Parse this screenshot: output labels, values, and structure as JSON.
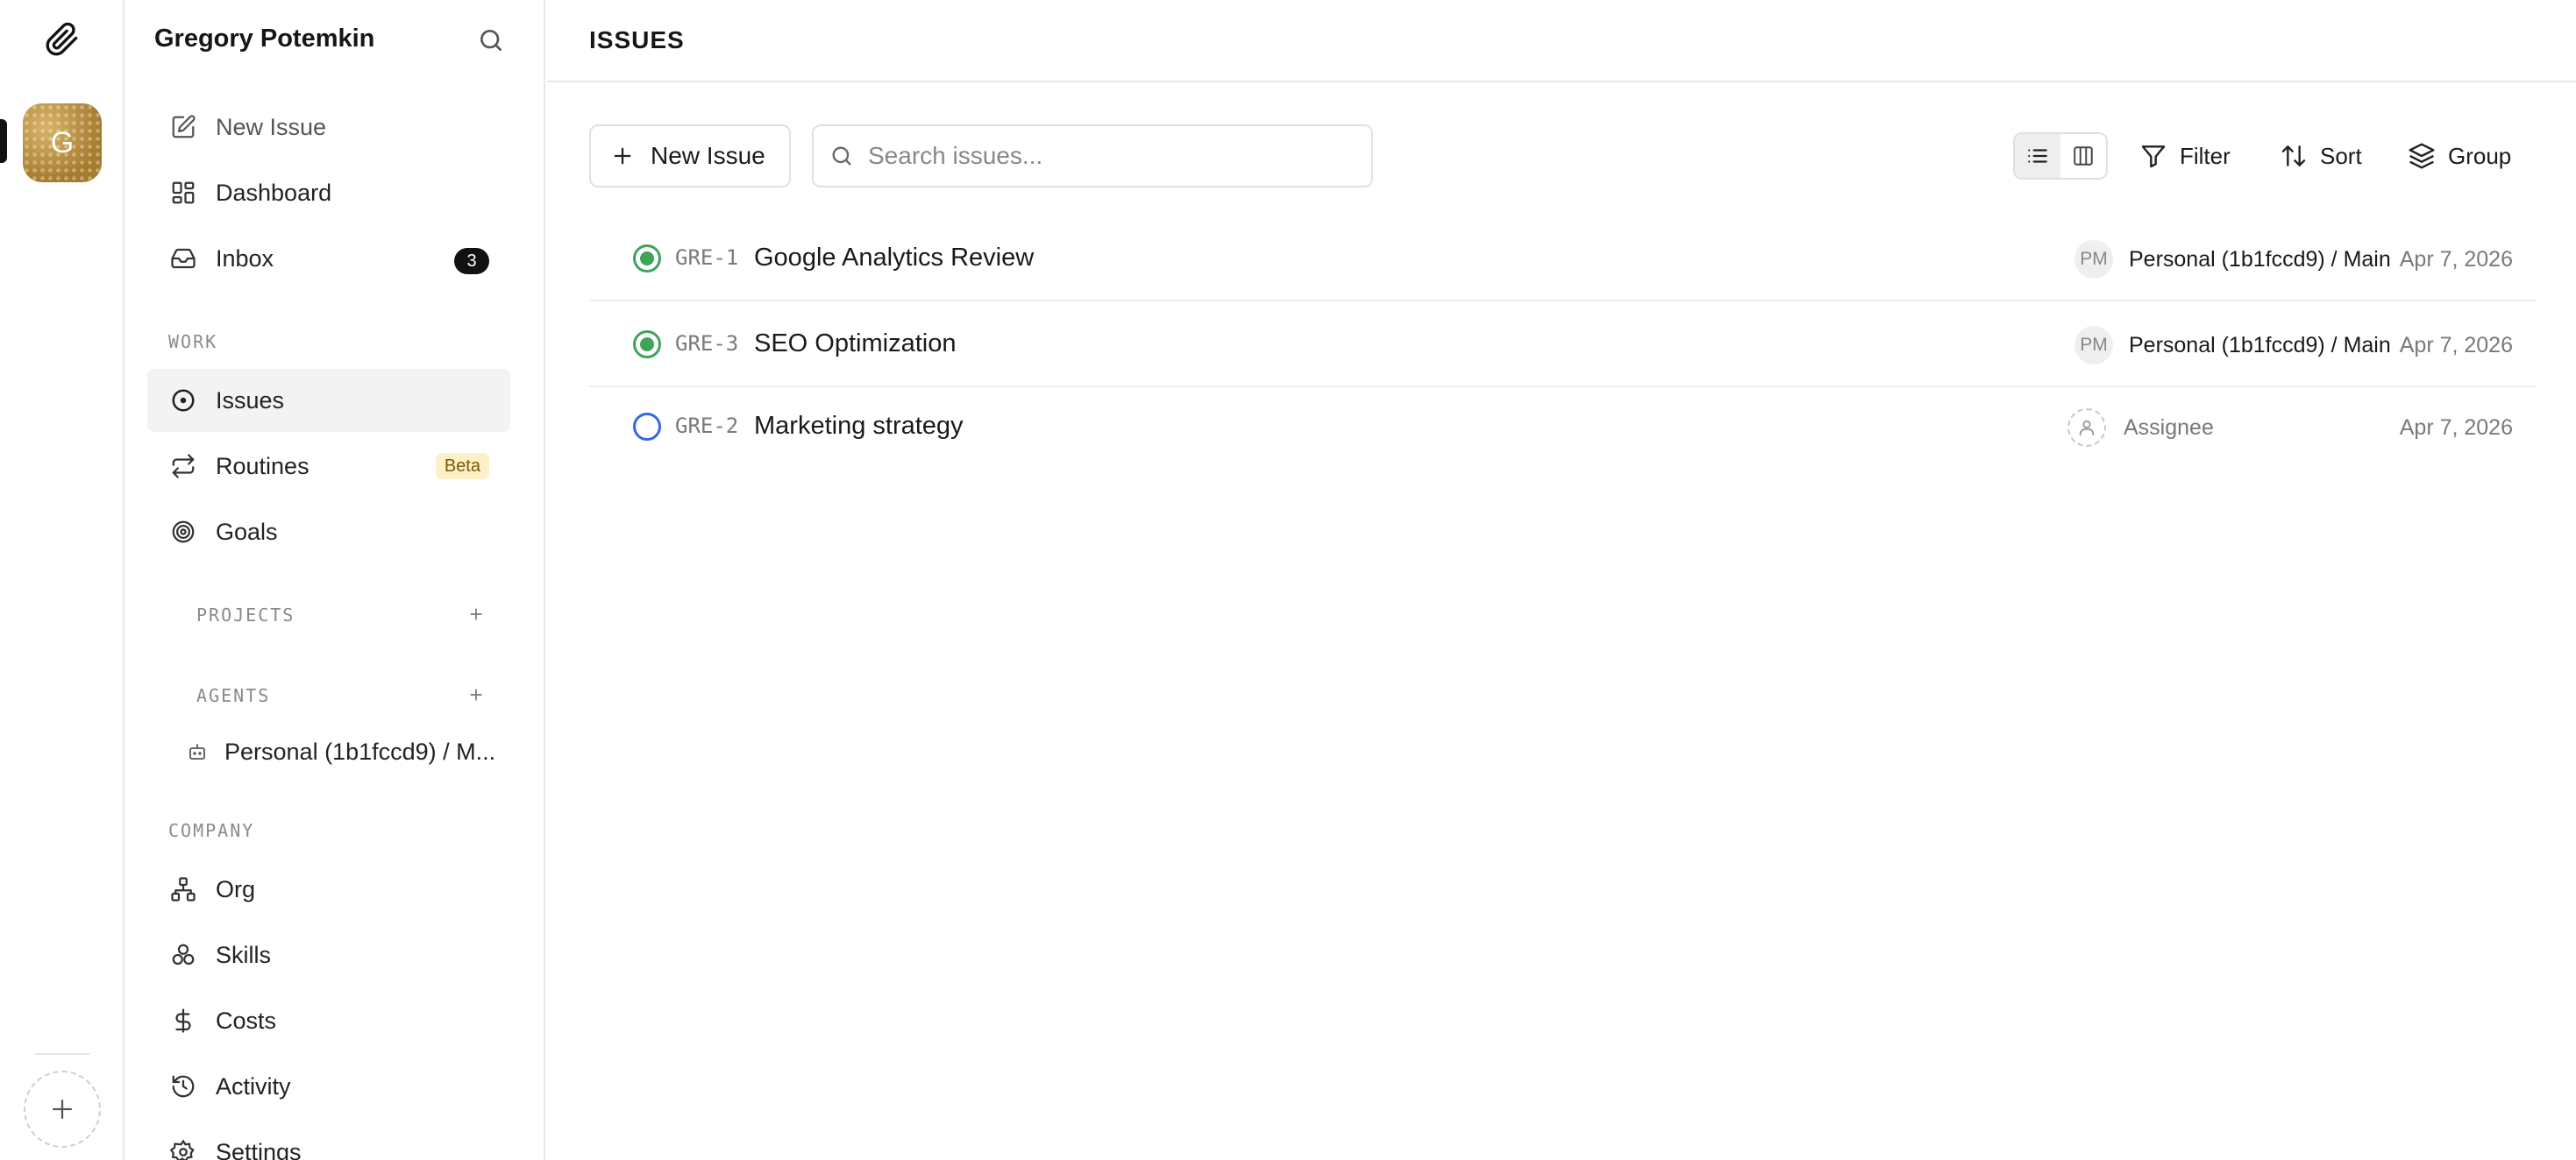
{
  "rail": {
    "avatar_letter": "G",
    "icons": {
      "logo": "paperclip-icon",
      "add": "plus-icon"
    }
  },
  "sidebar": {
    "workspace_name": "Gregory Potemkin",
    "top_items": [
      {
        "label": "New Issue",
        "icon": "edit-icon"
      },
      {
        "label": "Dashboard",
        "icon": "dashboard-icon"
      },
      {
        "label": "Inbox",
        "icon": "inbox-icon",
        "badge": "3"
      }
    ],
    "work_label": "WORK",
    "work_items": [
      {
        "label": "Issues",
        "icon": "circle-dot-icon",
        "active": true
      },
      {
        "label": "Routines",
        "icon": "repeat-icon",
        "badge": "Beta"
      },
      {
        "label": "Goals",
        "icon": "target-icon"
      }
    ],
    "projects_label": "PROJECTS",
    "agents_label": "AGENTS",
    "agents": [
      {
        "label": "Personal (1b1fccd9) / M...",
        "icon": "bot-icon"
      }
    ],
    "company_label": "COMPANY",
    "company_items": [
      {
        "label": "Org",
        "icon": "org-chart-icon"
      },
      {
        "label": "Skills",
        "icon": "skills-icon"
      },
      {
        "label": "Costs",
        "icon": "dollar-icon"
      },
      {
        "label": "Activity",
        "icon": "history-icon"
      },
      {
        "label": "Settings",
        "icon": "gear-icon"
      }
    ]
  },
  "main": {
    "title": "ISSUES",
    "new_issue_label": "New Issue",
    "search_placeholder": "Search issues...",
    "toolbar": {
      "filter_label": "Filter",
      "sort_label": "Sort",
      "group_label": "Group"
    },
    "issues": [
      {
        "key": "GRE-1",
        "title": "Google Analytics Review",
        "status": "done",
        "assignee_initials": "PM",
        "project": "Personal (1b1fccd9) / Main",
        "date": "Apr 7, 2026"
      },
      {
        "key": "GRE-3",
        "title": "SEO Optimization",
        "status": "done",
        "assignee_initials": "PM",
        "project": "Personal (1b1fccd9) / Main",
        "date": "Apr 7, 2026"
      },
      {
        "key": "GRE-2",
        "title": "Marketing strategy",
        "status": "todo",
        "assignee_placeholder": "Assignee",
        "date": "Apr 7, 2026"
      }
    ]
  },
  "colors": {
    "status_done": "#3fa35a",
    "status_todo": "#3569e0",
    "beta_badge_bg": "#fdf0c8"
  }
}
